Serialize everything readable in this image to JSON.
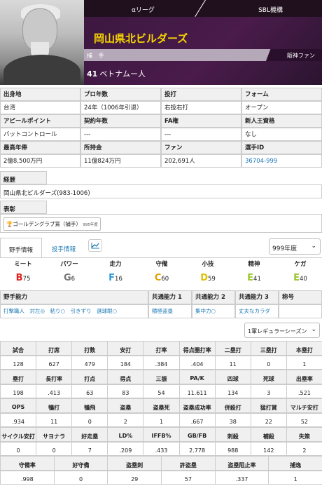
{
  "header": {
    "league": "αリーグ",
    "org": "SBL機構",
    "team_name": "岡山県北ビルダーズ",
    "position": "捕 手",
    "fan": "阪神ファン",
    "number": "41",
    "player_name": "ベトナムー人"
  },
  "profile": {
    "rows": [
      [
        {
          "label": "出身地",
          "value": "台湾"
        },
        {
          "label": "プロ年数",
          "value": "24年（1006年引退）"
        },
        {
          "label": "投打",
          "value": "右投右打"
        },
        {
          "label": "フォーム",
          "value": "オープン"
        }
      ],
      [
        {
          "label": "アピールポイント",
          "value": "バットコントロール"
        },
        {
          "label": "契約年数",
          "value": "---"
        },
        {
          "label": "FA権",
          "value": "---"
        },
        {
          "label": "新人王資格",
          "value": "なし"
        }
      ],
      [
        {
          "label": "最高年俸",
          "value": "2億8,500万円"
        },
        {
          "label": "所持金",
          "value": "11億824万円"
        },
        {
          "label": "ファン",
          "value": "202,691人"
        },
        {
          "label": "選手ID",
          "value": "36704-999"
        }
      ]
    ]
  },
  "career": {
    "label": "経歴",
    "value": "岡山県北ビルダーズ(983-1006)"
  },
  "awards": {
    "label": "表彰",
    "badge": "ゴールデングラブ賞（捕手）",
    "badge_year": "995年度"
  },
  "tabs": {
    "fielder": "野手情報",
    "pitcher": "投手情報",
    "year_select": "999年度"
  },
  "abilities": [
    {
      "label": "ミート",
      "grade": "B",
      "value": "75",
      "color": "#e02020"
    },
    {
      "label": "パワー",
      "grade": "G",
      "value": "6",
      "color": "#777777"
    },
    {
      "label": "走力",
      "grade": "F",
      "value": "16",
      "color": "#2e9bd6"
    },
    {
      "label": "守備",
      "grade": "C",
      "value": "60",
      "color": "#e0a000"
    },
    {
      "label": "小技",
      "grade": "D",
      "value": "59",
      "color": "#e0c000"
    },
    {
      "label": "精神",
      "grade": "E",
      "value": "41",
      "color": "#9ac82e"
    },
    {
      "label": "ケガ",
      "grade": "E",
      "value": "40",
      "color": "#9ac82e"
    }
  ],
  "skills": {
    "headers": [
      "野手能力",
      "共通能力 1",
      "共通能力 2",
      "共通能力 3",
      "称号"
    ],
    "values": [
      "打撃職人　対左◎　粘り○　引きずり　選球眼○",
      "積極盗塁",
      "集中力○",
      "丈夫なカラダ",
      ""
    ]
  },
  "season_select": "1軍レギュラーシーズン",
  "stats": [
    {
      "h": [
        "試合",
        "打席",
        "打数",
        "安打",
        "打率",
        "得点圏打率",
        "二塁打",
        "三塁打",
        "本塁打"
      ],
      "v": [
        "128",
        "627",
        "479",
        "184",
        ".384",
        ".404",
        "11",
        "0",
        "1"
      ]
    },
    {
      "h": [
        "塁打",
        "長打率",
        "打点",
        "得点",
        "三振",
        "PA/K",
        "四球",
        "死球",
        "出塁率"
      ],
      "v": [
        "198",
        ".413",
        "63",
        "83",
        "54",
        "11.611",
        "134",
        "3",
        ".521"
      ]
    },
    {
      "h": [
        "OPS",
        "犠打",
        "犠飛",
        "盗塁",
        "盗塁死",
        "盗塁成功率",
        "併殺打",
        "猛打賞",
        "マルチ安打"
      ],
      "v": [
        ".934",
        "11",
        "0",
        "2",
        "1",
        ".667",
        "38",
        "22",
        "52"
      ]
    },
    {
      "h": [
        "サイクル安打",
        "サヨナラ",
        "好走塁",
        "LD%",
        "IFFB%",
        "GB/FB",
        "刺殺",
        "補殺",
        "失策"
      ],
      "v": [
        "0",
        "0",
        "7",
        ".209",
        ".433",
        "2.778",
        "988",
        "142",
        "2"
      ]
    }
  ],
  "stats_last": {
    "h": [
      "守備率",
      "好守備",
      "盗塁刺",
      "許盗塁",
      "盗塁阻止率",
      "捕逸"
    ],
    "v": [
      ".998",
      "0",
      "29",
      "57",
      ".337",
      "1"
    ]
  }
}
